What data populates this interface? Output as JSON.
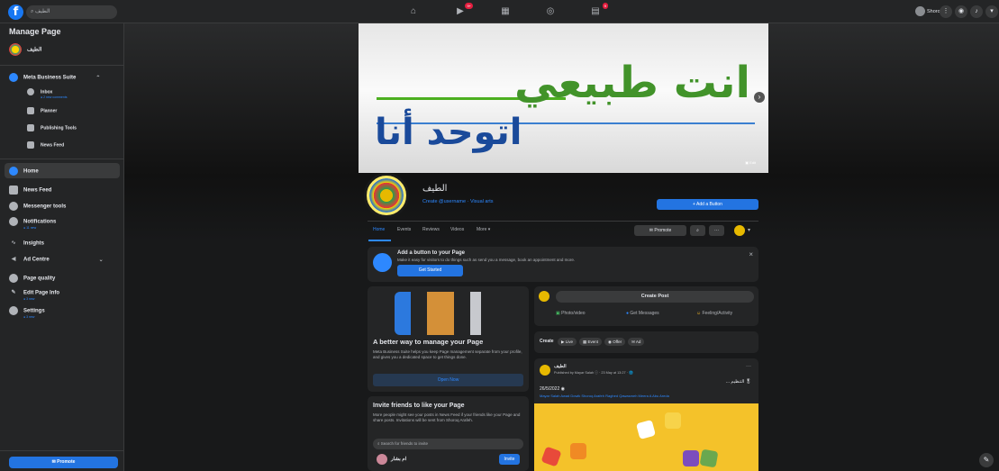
{
  "topbar": {
    "search_placeholder": "الطيف",
    "user_name": "Shoroq",
    "notifications_badge": "9+",
    "alerts_badge": "9",
    "logo": "f"
  },
  "sidebar": {
    "title": "Manage Page",
    "page_name": "الطيف",
    "mbs": "Meta Business Suite",
    "inbox": "Inbox",
    "inbox_sub": "● 2 new comments",
    "planner": "Planner",
    "publishing": "Publishing Tools",
    "newsfeed_sub": "News Feed",
    "home": "Home",
    "newsfeed": "News Feed",
    "messenger": "Messenger tools",
    "notifications": "Notifications",
    "notifications_sub": "● 11 new",
    "insights": "Insights",
    "ad_centre": "Ad Centre",
    "page_quality": "Page quality",
    "edit_info": "Edit Page Info",
    "edit_sub": "● 3 new",
    "settings": "Settings",
    "settings_sub": "● 3 new",
    "promote": "Promote"
  },
  "cover": {
    "line1": "انت طبيعي",
    "line2": "اتوحد أنا",
    "edit": "Edit"
  },
  "profile": {
    "name": "الطيف",
    "username_link": "Create @username",
    "category": " · Visual arts",
    "add_button": "+ Add a Button"
  },
  "tabs": [
    "Home",
    "Events",
    "Reviews",
    "Videos",
    "More ▾"
  ],
  "tab_buttons": {
    "promote": "Promote",
    "search": "⌕",
    "more": "···"
  },
  "add_button_card": {
    "title": "Add a button to your Page",
    "desc": "Make it easy for visitors to do things such as send you a message, book an appointment and more.",
    "cta": "Get Started"
  },
  "mbs_card": {
    "title": "A better way to manage your Page",
    "desc": "Meta Business Suite helps you keep Page management separate from your profile, and gives you a dedicated space to get things done.",
    "cta": "Open Now"
  },
  "invite_card": {
    "title": "Invite friends to like your Page",
    "desc": "More people might see your posts in News Feed if your friends like your Page and share posts. Invitations will be sent from Shoroq Arafeh.",
    "search_placeholder": "Search for friends to invite",
    "friend": "ام بشار",
    "invite": "Invite"
  },
  "create_post": {
    "label": "Create Post",
    "photo": "Photo/video",
    "messages": "Get Messages",
    "feeling": "Feeling/Activity"
  },
  "create_row": {
    "label": "Create",
    "live": "Live",
    "event": "Event",
    "offer": "Offer",
    "ad": "Ad"
  },
  "post": {
    "author": "الطيف",
    "meta": "Published by Mayar Salah ⓘ · 23 May at 13:27 · 🌐",
    "text1": "... التنظيم 🎖",
    "date": "26/5/2022 ◉",
    "tags": "Mayar Salah Awad Dowik Shoroq Arafeh Raghed Qawasmeh Meera A Abu Areda"
  }
}
